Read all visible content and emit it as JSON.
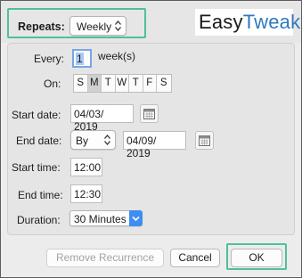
{
  "header": {
    "repeats_label": "Repeats:",
    "repeats_value": "Weekly",
    "logo_part1": "Easy",
    "logo_part2": "Tweaks"
  },
  "form": {
    "every_label": "Every:",
    "every_value": "1",
    "every_unit": "week(s)",
    "on_label": "On:",
    "days": [
      "S",
      "M",
      "T",
      "W",
      "T",
      "F",
      "S"
    ],
    "selected_day_index": 1,
    "start_date_label": "Start date:",
    "start_date_value": "04/03/ 2019",
    "end_date_label": "End date:",
    "end_by_value": "By",
    "end_date_value": "04/09/ 2019",
    "start_time_label": "Start time:",
    "start_time_value": "12:00",
    "end_time_label": "End time:",
    "end_time_value": "12:30",
    "duration_label": "Duration:",
    "duration_value": "30 Minutes"
  },
  "buttons": {
    "remove_recurrence": "Remove Recurrence",
    "cancel": "Cancel",
    "ok": "OK"
  },
  "colors": {
    "highlight": "#4fbf9e",
    "logo_accent": "#2f79c0",
    "select_accent": "#3d8ef0"
  }
}
